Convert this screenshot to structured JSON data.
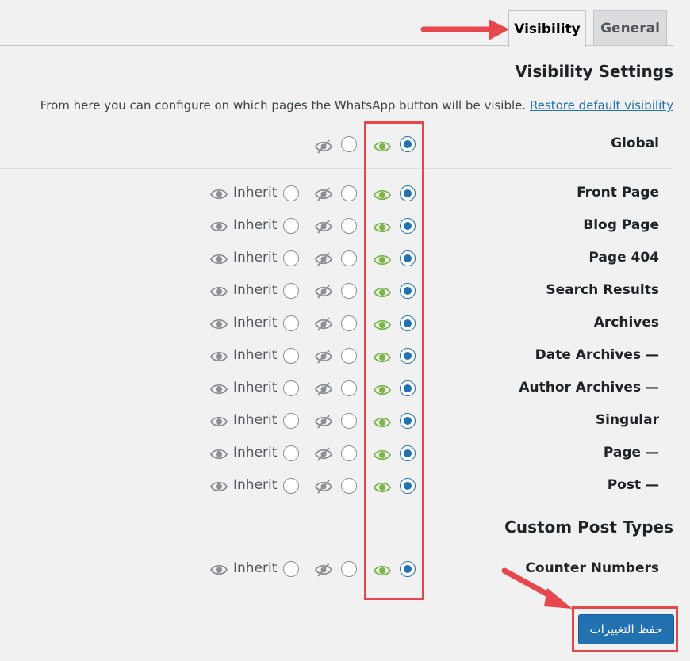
{
  "tabs": [
    {
      "label": "Visibility",
      "active": true
    },
    {
      "label": "General",
      "active": false
    }
  ],
  "visibility": {
    "title": "Visibility Settings",
    "description": "From here you can configure on which pages the WhatsApp button will be visible.",
    "restore_link": "Restore default visibility",
    "global_label": "Global",
    "inherit_label": "Inherit",
    "rows": [
      {
        "label": "Front Page"
      },
      {
        "label": "Blog Page"
      },
      {
        "label": "Page 404"
      },
      {
        "label": "Search Results"
      },
      {
        "label": "Archives"
      },
      {
        "label": "Date Archives —"
      },
      {
        "label": "Author Archives —"
      },
      {
        "label": "Singular"
      },
      {
        "label": "Page —"
      },
      {
        "label": "Post —"
      }
    ],
    "selected_option": "show"
  },
  "custom_post_types": {
    "title": "Custom Post Types",
    "rows": [
      {
        "label": "Counter Numbers"
      }
    ]
  },
  "save_button": "حفظ التغييرات",
  "colors": {
    "accent": "#2271b1",
    "eye_show": "#7ab646",
    "eye_hide": "#8c8f94",
    "highlight": "#e5474d"
  }
}
